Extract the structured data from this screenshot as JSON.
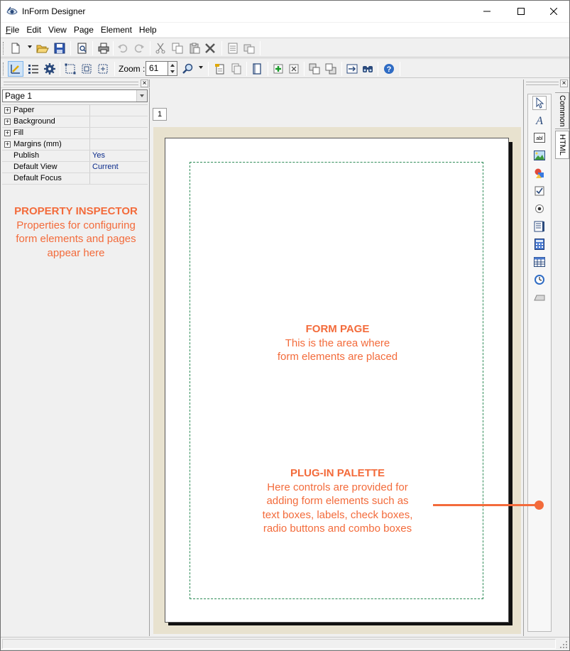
{
  "window": {
    "title": "InForm Designer",
    "controls": {
      "minimize": "minimize",
      "maximize": "maximize",
      "close": "close"
    }
  },
  "menu": [
    {
      "label": "File",
      "underline": "F",
      "rest": "ile"
    },
    {
      "label": "Edit"
    },
    {
      "label": "View"
    },
    {
      "label": "Page"
    },
    {
      "label": "Element"
    },
    {
      "label": "Help"
    }
  ],
  "toolbar1": {
    "icons": [
      "new-document-icon",
      "open-folder-icon",
      "save-icon",
      "print-preview-icon",
      "print-icon",
      "undo-icon",
      "redo-icon",
      "cut-icon",
      "copy-icon",
      "paste-icon",
      "delete-icon",
      "properties-icon",
      "clone-icon"
    ]
  },
  "toolbar2": {
    "zoom_label": "Zoom :",
    "zoom_value": "61",
    "icons": [
      "design-mode-icon",
      "list-icon",
      "settings-gear-icon",
      "select-frame-icon",
      "align-frame-icon",
      "fit-frame-icon",
      "zoom-magnifier-icon",
      "page-icon",
      "page-copy-icon",
      "single-page-icon",
      "add-page-icon",
      "remove-page-icon",
      "bring-front-icon",
      "send-back-icon",
      "tab-order-icon",
      "find-icon",
      "help-icon"
    ]
  },
  "property_inspector": {
    "selected_page": "Page 1",
    "rows": [
      {
        "name": "Paper",
        "value": "",
        "expandable": true
      },
      {
        "name": "Background",
        "value": "",
        "expandable": true
      },
      {
        "name": "Fill",
        "value": "",
        "expandable": true
      },
      {
        "name": "Margins (mm)",
        "value": "",
        "expandable": true
      },
      {
        "name": "Publish",
        "value": "Yes",
        "expandable": false
      },
      {
        "name": "Default View",
        "value": "Current",
        "expandable": false
      },
      {
        "name": "Default Focus",
        "value": "",
        "expandable": false
      }
    ],
    "annotation": {
      "heading": "PROPERTY INSPECTOR",
      "lines": [
        "Properties for configuring",
        "form elements and pages",
        "appear here"
      ]
    }
  },
  "canvas": {
    "page_tab": "1",
    "form_page_annotation": {
      "heading": "FORM PAGE",
      "lines": [
        "This is the area where",
        "form elements are placed"
      ]
    },
    "palette_annotation": {
      "heading": "PLUG-IN PALETTE",
      "lines": [
        "Here controls are provided for",
        "adding form elements such as",
        "text boxes, labels, check boxes,",
        "radio buttons and combo boxes"
      ]
    }
  },
  "palette": {
    "tabs": [
      "Common",
      "HTML"
    ],
    "tools": [
      "pointer-icon",
      "label-text-icon",
      "text-box-icon",
      "image-icon",
      "shapes-icon",
      "checkbox-icon",
      "radio-button-icon",
      "list-box-icon",
      "calculator-icon",
      "table-icon",
      "clock-icon",
      "button-icon"
    ]
  },
  "colors": {
    "annotation": "#f36b3b",
    "margin_guide": "#2e8b57",
    "page_surround": "#e8e2cf"
  }
}
